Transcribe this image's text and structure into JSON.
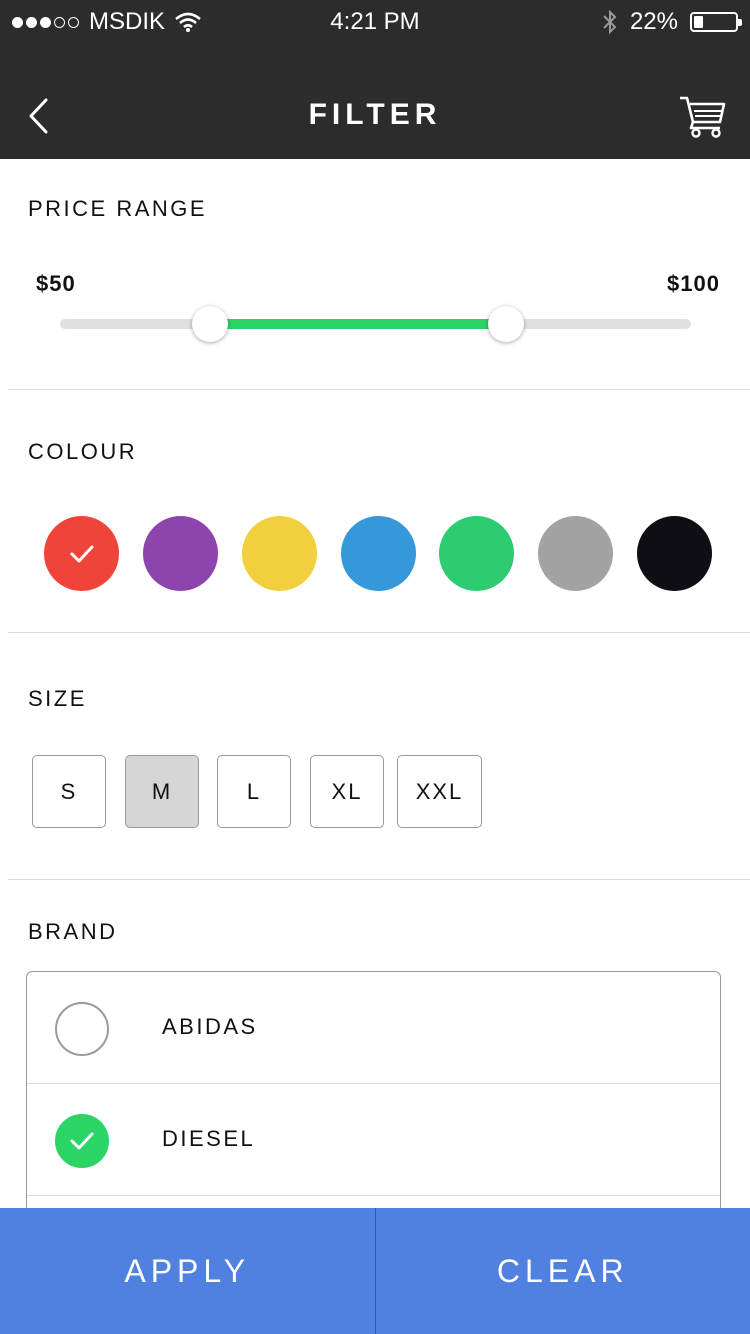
{
  "status_bar": {
    "carrier": "MSDIK",
    "time": "4:21 PM",
    "battery": "22%",
    "battery_level": 0.22
  },
  "header": {
    "title": "FILTER",
    "back_icon": "chevron-left-icon",
    "cart_icon": "cart-icon"
  },
  "price_range": {
    "title": "PRICE RANGE",
    "min_label": "$50",
    "max_label": "$100"
  },
  "colour": {
    "title": "COLOUR",
    "swatches": [
      {
        "name": "red",
        "hex": "#f0443a",
        "selected": true
      },
      {
        "name": "purple",
        "hex": "#8e44ad",
        "selected": false
      },
      {
        "name": "yellow",
        "hex": "#f2cf3d",
        "selected": false
      },
      {
        "name": "blue",
        "hex": "#3498db",
        "selected": false
      },
      {
        "name": "green",
        "hex": "#2ecc71",
        "selected": false
      },
      {
        "name": "grey",
        "hex": "#a3a3a3",
        "selected": false
      },
      {
        "name": "black",
        "hex": "#0e0e14",
        "selected": false
      }
    ]
  },
  "size": {
    "title": "SIZE",
    "options": [
      {
        "label": "S",
        "selected": false
      },
      {
        "label": "M",
        "selected": true
      },
      {
        "label": "L",
        "selected": false
      },
      {
        "label": "XL",
        "selected": false
      },
      {
        "label": "XXL",
        "selected": false
      }
    ]
  },
  "brand": {
    "title": "BRAND",
    "items": [
      {
        "label": "ABIDAS",
        "checked": false
      },
      {
        "label": "DIESEL",
        "checked": true
      }
    ]
  },
  "actions": {
    "apply_label": "APPLY",
    "clear_label": "CLEAR"
  },
  "colors": {
    "header_bg": "#2c2c2c",
    "accent_green": "#2cd466",
    "action_blue": "#5080e0"
  }
}
